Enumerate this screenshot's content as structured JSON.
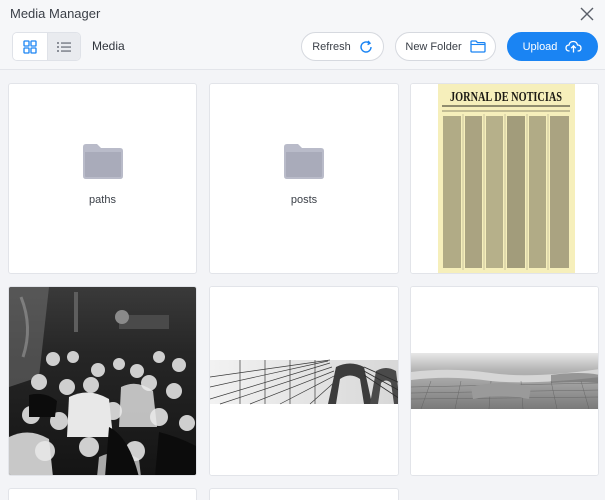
{
  "window": {
    "title": "Media Manager",
    "close_icon": "close-icon"
  },
  "toolbar": {
    "view_grid_icon": "grid-view-icon",
    "view_list_icon": "list-view-icon",
    "breadcrumb": "Media",
    "refresh_label": "Refresh",
    "new_folder_label": "New Folder",
    "upload_label": "Upload"
  },
  "colors": {
    "accent": "#1a84f3",
    "folder": "#b9bbc9",
    "background": "#f3f4f7"
  },
  "items": [
    {
      "type": "folder",
      "name": "paths"
    },
    {
      "type": "folder",
      "name": "posts"
    },
    {
      "type": "image",
      "name": "newspaper",
      "masthead": "JORNAL DE NOTICIAS"
    },
    {
      "type": "image",
      "name": "crowd-photo"
    },
    {
      "type": "image",
      "name": "bridge-cables"
    },
    {
      "type": "image",
      "name": "city-aerial"
    }
  ]
}
